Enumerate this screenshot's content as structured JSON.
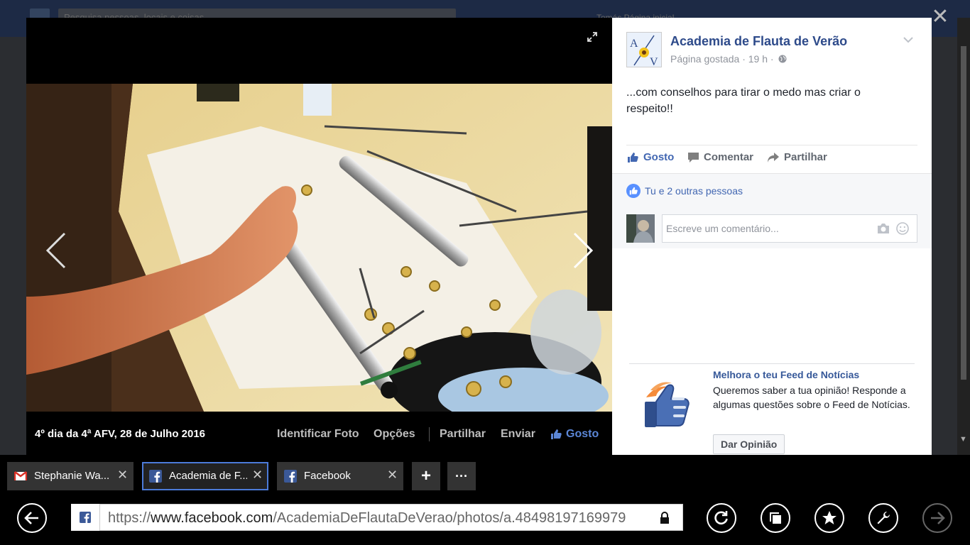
{
  "background_page": {
    "search_placeholder": "Pesquisa pessoas, locais e coisas",
    "nav_text": "Tomás    Página inicial"
  },
  "viewer": {
    "close_icon": "close-icon",
    "caption": "4º dia da 4ª AFV, 28 de Julho 2016",
    "tag_photo": "Identificar Foto",
    "options": "Opções",
    "share": "Partilhar",
    "send": "Enviar",
    "like": "Gosto"
  },
  "post": {
    "page_name": "Academia de Flauta de Verão",
    "meta": "Página gostada · 19 h ·",
    "text": "...com conselhos para tirar o medo mas criar o respeito!!",
    "actions": {
      "like": "Gosto",
      "comment": "Comentar",
      "share": "Partilhar"
    },
    "likes_summary": "Tu e 2 outras pessoas",
    "comment_placeholder": "Escreve um comentário..."
  },
  "promo": {
    "title": "Melhora o teu Feed de Notícias",
    "text": "Queremos saber a tua opinião! Responde a algumas questões sobre o Feed de Notícias.",
    "button": "Dar Opinião"
  },
  "browser": {
    "tabs": [
      {
        "label": "Stephanie Wa...",
        "icon": "gmail-icon"
      },
      {
        "label": "Academia de F...",
        "icon": "facebook-icon",
        "active": true
      },
      {
        "label": "Facebook",
        "icon": "facebook-icon"
      }
    ],
    "new_tab": "+",
    "more": "···",
    "url_prefix": "https://",
    "url_host": "www.facebook.com",
    "url_path": "/AcademiaDeFlautaDeVerao/photos/a.48498197169979"
  },
  "colors": {
    "facebook_blue": "#4267b2",
    "link_blue": "#365899",
    "active_tab_border": "#4c7bd9"
  }
}
